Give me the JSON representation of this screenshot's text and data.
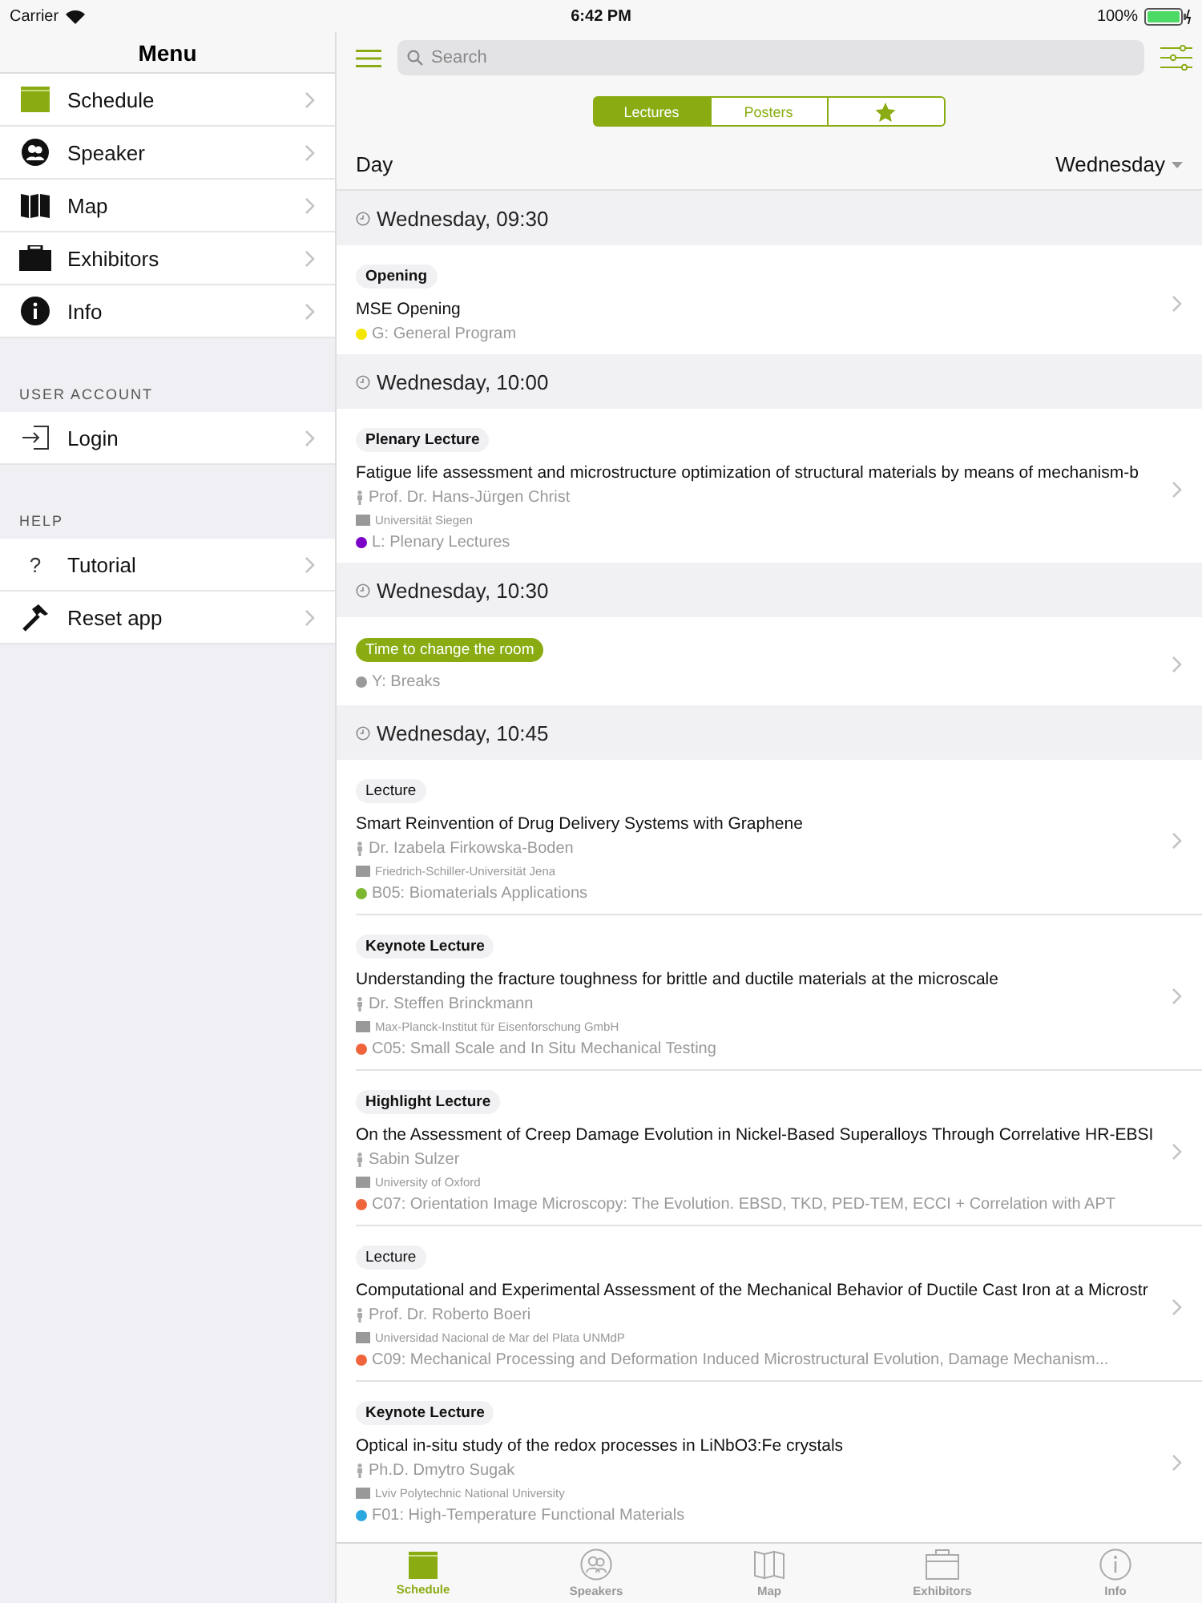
{
  "status_bar": {
    "carrier": "Carrier",
    "time": "6:42 PM",
    "battery": "100%"
  },
  "sidebar": {
    "title": "Menu",
    "sections": [
      {
        "items": [
          {
            "label": "Schedule"
          },
          {
            "label": "Speaker"
          },
          {
            "label": "Map"
          },
          {
            "label": "Exhibitors"
          },
          {
            "label": "Info"
          }
        ]
      },
      {
        "heading": "USER ACCOUNT",
        "items": [
          {
            "label": "Login"
          }
        ]
      },
      {
        "heading": "HELP",
        "items": [
          {
            "label": "Tutorial",
            "glyph": "?"
          },
          {
            "label": "Reset app"
          }
        ]
      }
    ]
  },
  "search": {
    "placeholder": "Search"
  },
  "segments": [
    {
      "kind": "text",
      "label": "Lectures",
      "selected": true
    },
    {
      "kind": "text",
      "label": "Posters",
      "selected": false
    },
    {
      "kind": "star",
      "selected": false
    }
  ],
  "day_filter": {
    "label": "Day",
    "value": "Wednesday"
  },
  "sessions": [
    {
      "time": "Wednesday, 09:30",
      "events": [
        {
          "kind": "lecture",
          "tag": "Opening",
          "emphasized": true,
          "title": "MSE Opening",
          "track": "G: General Program",
          "color": "#f5e600"
        }
      ]
    },
    {
      "time": "Wednesday, 10:00",
      "events": [
        {
          "kind": "lecture",
          "tag": "Plenary Lecture",
          "emphasized": true,
          "title": "Fatigue life assessment and microstructure optimization of structural materials by means of mechanism-b",
          "speaker": "Prof. Dr. Hans-Jürgen Christ",
          "affiliation": "Universität Siegen",
          "track": "L: Plenary Lectures",
          "color": "#7a00c8"
        }
      ]
    },
    {
      "time": "Wednesday, 10:30",
      "events": [
        {
          "kind": "break",
          "tag": "Time to change the room",
          "emphasized": false,
          "track": "Y: Breaks",
          "color": "#9a9a9a"
        }
      ]
    },
    {
      "time": "Wednesday, 10:45",
      "events": [
        {
          "kind": "lecture",
          "tag": "Lecture",
          "emphasized": false,
          "title": "Smart Reinvention of Drug Delivery Systems with Graphene",
          "speaker": "Dr. Izabela Firkowska-Boden",
          "affiliation": "Friedrich-Schiller-Universität Jena",
          "track": "B05: Biomaterials Applications",
          "color": "#7cb82f"
        },
        {
          "kind": "lecture",
          "tag": "Keynote Lecture",
          "emphasized": true,
          "title": "Understanding the fracture toughness for brittle and ductile materials at the microscale",
          "speaker": "Dr. Steffen Brinckmann",
          "affiliation": "Max-Planck-Institut für Eisenforschung GmbH",
          "track": "C05: Small Scale and In Situ Mechanical Testing",
          "color": "#f0643c"
        },
        {
          "kind": "lecture",
          "tag": "Highlight Lecture",
          "emphasized": true,
          "title": "On the Assessment of Creep Damage Evolution in Nickel-Based Superalloys Through Correlative HR-EBSI",
          "speaker": "Sabin Sulzer",
          "affiliation": "University of Oxford",
          "track": "C07: Orientation Image Microscopy: The Evolution. EBSD, TKD, PED-TEM, ECCI + Correlation with APT",
          "color": "#f0643c"
        },
        {
          "kind": "lecture",
          "tag": "Lecture",
          "emphasized": false,
          "title": "Computational and Experimental Assessment of the Mechanical Behavior of Ductile Cast Iron at a Microstr",
          "speaker": "Prof. Dr. Roberto Boeri",
          "affiliation": "Universidad Nacional de Mar del Plata UNMdP",
          "track": "C09: Mechanical Processing and Deformation Induced Microstructural Evolution, Damage Mechanism...",
          "color": "#f0643c"
        },
        {
          "kind": "lecture",
          "tag": "Keynote Lecture",
          "emphasized": true,
          "title": "Optical in-situ study of the redox processes in LiNbO3:Fe crystals",
          "speaker": "Ph.D. Dmytro Sugak",
          "affiliation": "Lviv Polytechnic National University",
          "track": "F01: High-Temperature Functional Materials",
          "color": "#2aa8e0"
        }
      ]
    }
  ],
  "tab_bar": [
    {
      "label": "Schedule",
      "selected": true
    },
    {
      "label": "Speakers",
      "selected": false
    },
    {
      "label": "Map",
      "selected": false
    },
    {
      "label": "Exhibitors",
      "selected": false
    },
    {
      "label": "Info",
      "selected": false
    }
  ]
}
